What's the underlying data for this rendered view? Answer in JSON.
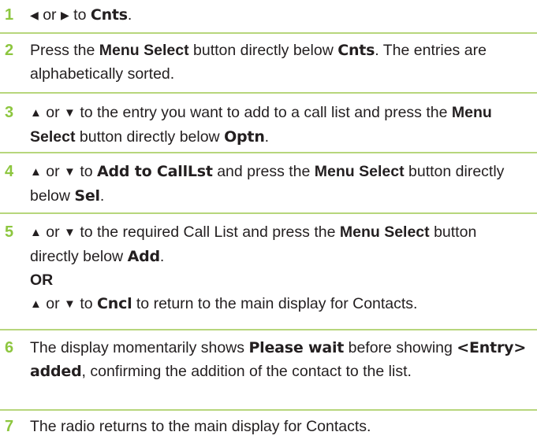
{
  "colors": {
    "step_number": "#8dc63f",
    "rule": "#b7d67c",
    "text": "#231f20"
  },
  "icons": {
    "left": "left-arrow-icon",
    "right": "right-arrow-icon",
    "up": "up-arrow-icon",
    "down": "down-arrow-icon"
  },
  "steps": [
    {
      "number": "1",
      "t_or": "or",
      "t_to": "to",
      "d_cnts": "Cnts",
      "t_end": "."
    },
    {
      "number": "2",
      "t1": "Press the",
      "b_menu": "Menu Select",
      "t2": "button directly below",
      "d_cnts": "Cnts",
      "t3": ". The entries are alphabetically sorted."
    },
    {
      "number": "3",
      "t_or": "or",
      "t1": "to the entry you want to add to a call list and press the",
      "b_menu": "Menu Select",
      "t2": "button directly below",
      "d_optn": "Optn",
      "t_end": "."
    },
    {
      "number": "4",
      "t_or": "or",
      "t_to": "to",
      "d_add_to": "Add to CallLst",
      "t1": "and press the",
      "b_menu": "Menu Select",
      "t2": "button directly below",
      "d_sel": "Sel",
      "t_end": "."
    },
    {
      "number": "5",
      "t_or": "or",
      "t1": "to the required Call List and press the",
      "b_menu": "Menu Select",
      "t2": "button directly below",
      "d_add": "Add",
      "t_end": ".",
      "b_or": "OR",
      "t_or2": "or",
      "t_to2": "to",
      "d_cncl": "Cncl",
      "t3": "to return to the main display for Contacts."
    },
    {
      "number": "6",
      "t1": "The display momentarily shows",
      "d_wait": "Please wait",
      "t2": "before showing",
      "d_entry": "<Entry> added",
      "t3": ", confirming the addition of the contact to the list."
    },
    {
      "number": "7",
      "t1": "The radio returns to the main display for Contacts."
    }
  ]
}
